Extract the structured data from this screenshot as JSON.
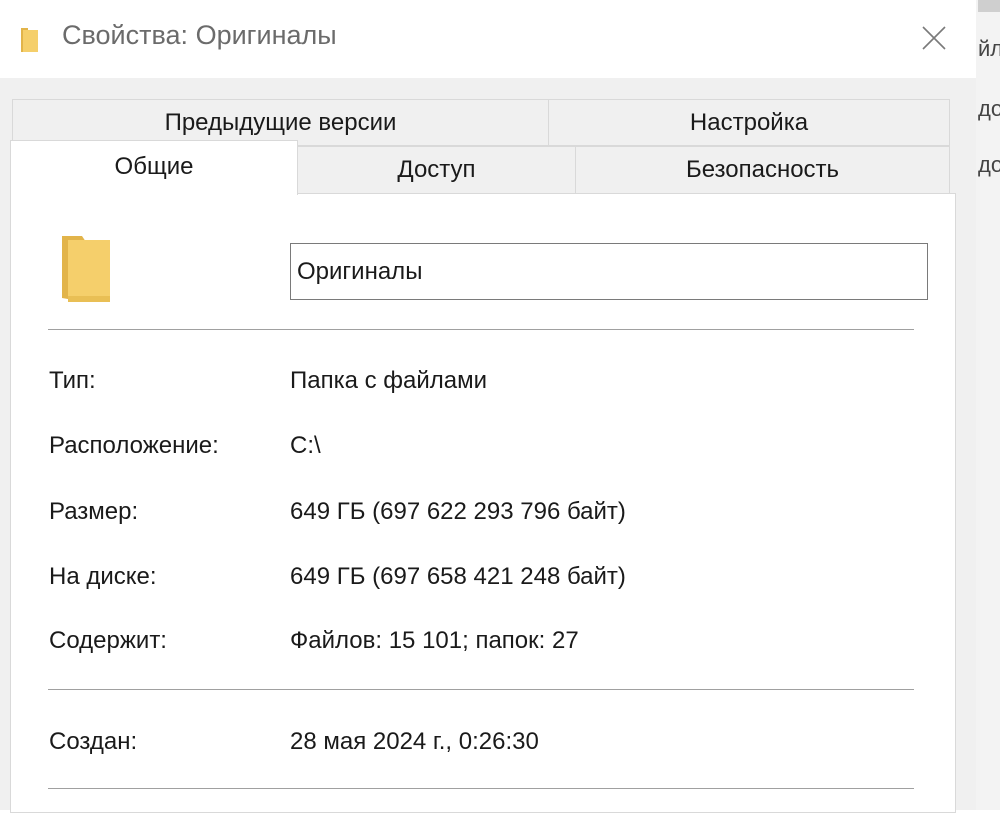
{
  "window": {
    "title": "Свойства: Оригиналы",
    "icon": "folder-icon",
    "close_icon": "close-icon"
  },
  "background": {
    "lines": [
      "йл",
      "до",
      "до"
    ]
  },
  "tabs": {
    "row_back": [
      {
        "label": "Предыдущие версии"
      },
      {
        "label": "Настройка"
      }
    ],
    "row_front": [
      {
        "label": "Общие",
        "active": true
      },
      {
        "label": "Доступ"
      },
      {
        "label": "Безопасность"
      }
    ]
  },
  "general": {
    "name_value": "Оригиналы",
    "folder_icon": "folder-icon",
    "properties": [
      {
        "label": "Тип:",
        "value": "Папка с файлами"
      },
      {
        "label": "Расположение:",
        "value": "C:\\"
      },
      {
        "label": "Размер:",
        "value": "649 ГБ (697 622 293 796 байт)"
      },
      {
        "label": "На диске:",
        "value": "649 ГБ (697 658 421 248 байт)"
      },
      {
        "label": "Содержит:",
        "value": "Файлов: 15 101; папок: 27"
      }
    ],
    "created": {
      "label": "Создан:",
      "value": "28 мая 2024 г., 0:26:30"
    }
  },
  "colors": {
    "folder": "#f5cf6b",
    "folder_dark": "#e2b44a",
    "dialog_bg": "#f0f0f0",
    "panel_bg": "#ffffff",
    "title_text": "#6b6b6b"
  }
}
